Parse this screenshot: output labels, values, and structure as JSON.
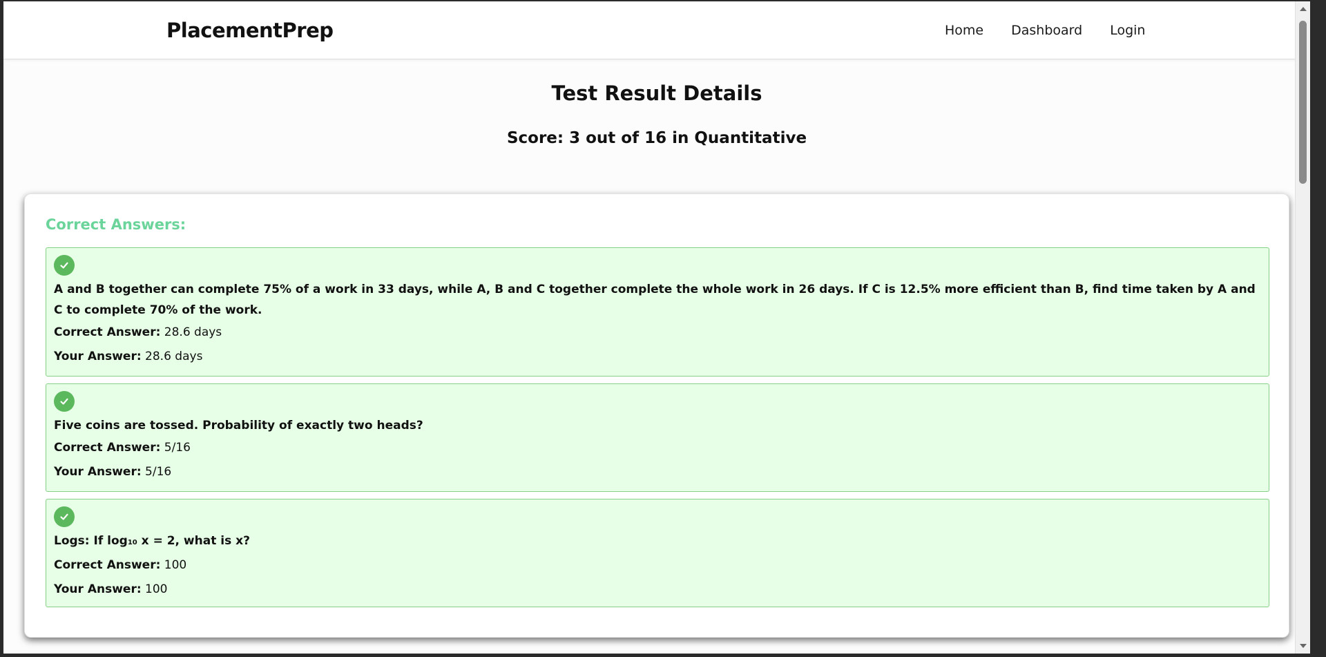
{
  "nav": {
    "brand": "PlacementPrep",
    "links": [
      {
        "label": "Home"
      },
      {
        "label": "Dashboard"
      },
      {
        "label": "Login"
      }
    ]
  },
  "page": {
    "title": "Test Result Details",
    "score": "Score: 3 out of 16 in Quantitative"
  },
  "correct_section": {
    "title": "Correct Answers:",
    "correct_label": "Correct Answer:",
    "your_label": "Your Answer:",
    "items": [
      {
        "question": "A and B together can complete 75% of a work in 33 days, while A, B and C together complete the whole work in 26 days. If C is 12.5% more efficient than B, find time taken by A and C to complete 70% of the work.",
        "correct_answer": "28.6 days",
        "your_answer": "28.6 days"
      },
      {
        "question": "Five coins are tossed. Probability of exactly two heads?",
        "correct_answer": "5/16",
        "your_answer": "5/16"
      },
      {
        "question_prefix": "Logs: If log",
        "question_sub": "10",
        "question_suffix": " x = 2, what is x?",
        "correct_answer": "100",
        "your_answer": "100"
      }
    ]
  },
  "icons": {
    "check": "check-circle-icon"
  },
  "colors": {
    "section_title": "#6bd49a",
    "item_bg": "#e6ffe6",
    "item_border": "#86cf86",
    "check": "#5cb85c"
  }
}
